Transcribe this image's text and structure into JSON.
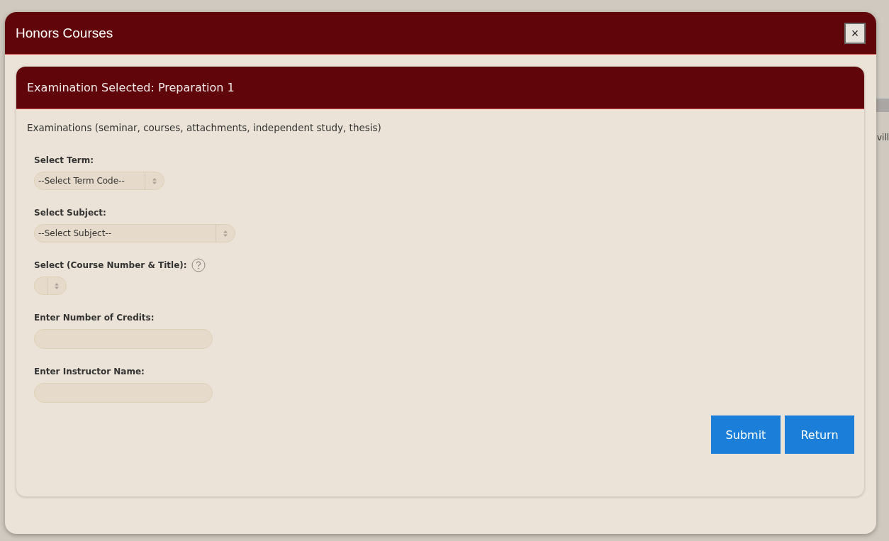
{
  "background_page": {
    "text_fragment": "vill"
  },
  "dialog": {
    "title": "Honors Courses",
    "close_label": "×"
  },
  "panel": {
    "title": "Examination Selected: Preparation 1",
    "description": "Examinations (seminar, courses, attachments, independent study, thesis)"
  },
  "fields": [
    {
      "kind": "select",
      "label": "Select Term:",
      "value": "--Select Term Code--"
    },
    {
      "kind": "select",
      "label": "Select Subject:",
      "value": "--Select Subject--"
    },
    {
      "kind": "select",
      "label": "Select (Course Number & Title):",
      "help": true
    },
    {
      "kind": "text",
      "label": "Enter Number of Credits:"
    },
    {
      "kind": "text",
      "label": "Enter Instructor Name:"
    }
  ],
  "buttons": [
    "Submit",
    "Return"
  ]
}
